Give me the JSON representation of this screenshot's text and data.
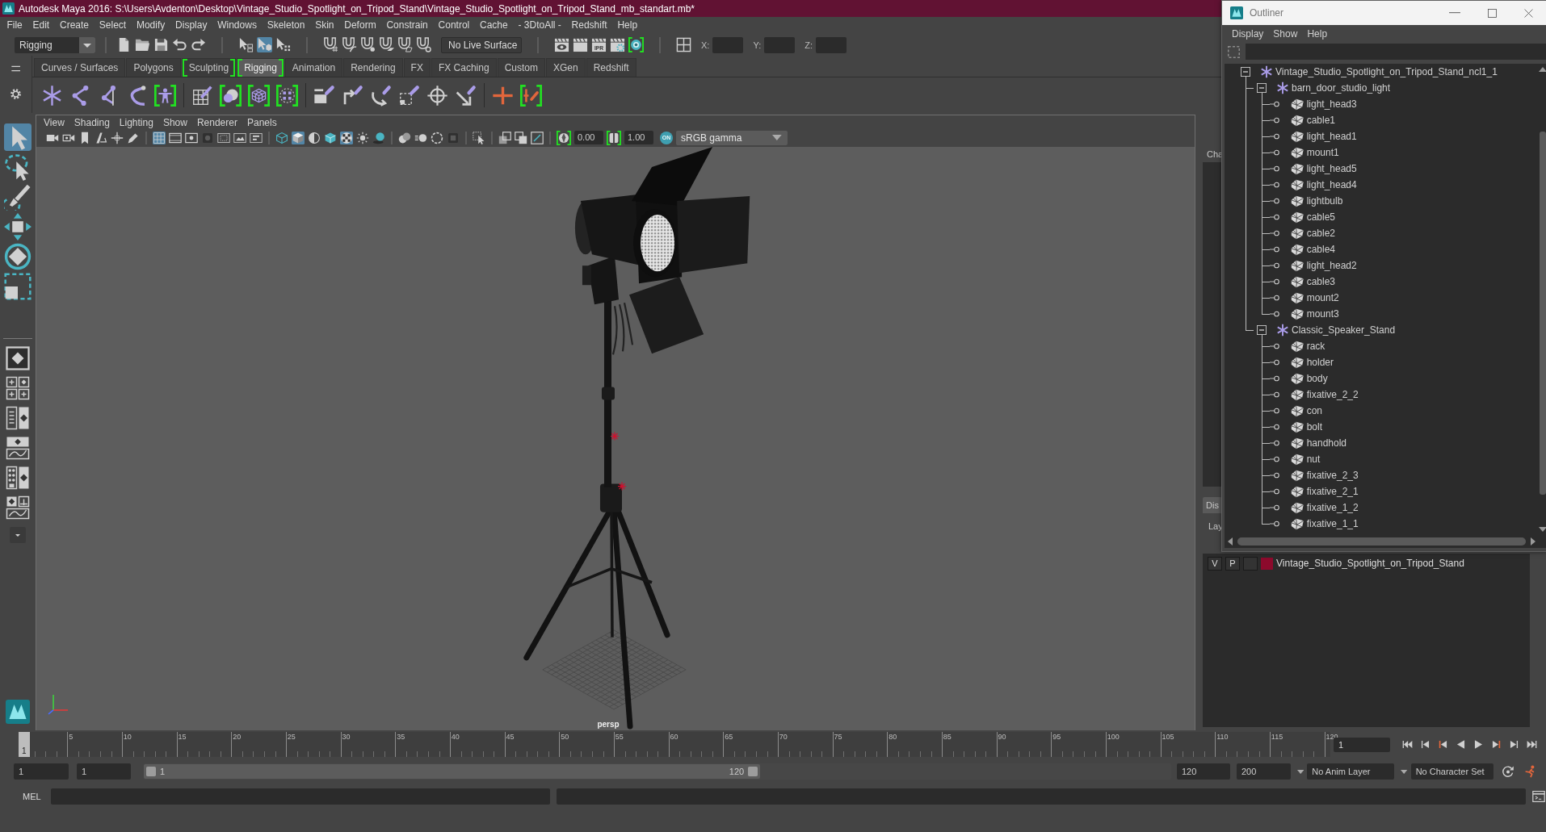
{
  "window": {
    "title": "Autodesk Maya 2016: S:\\Users\\Avdenton\\Desktop\\Vintage_Studio_Spotlight_on_Tripod_Stand\\Vintage_Studio_Spotlight_on_Tripod_Stand_mb_standart.mb*"
  },
  "menu_bar": [
    "File",
    "Edit",
    "Create",
    "Select",
    "Modify",
    "Display",
    "Windows",
    "Skeleton",
    "Skin",
    "Deform",
    "Constrain",
    "Control",
    "Cache",
    "- 3DtoAll -",
    "Redshift",
    "Help"
  ],
  "status_line": {
    "mode": "Rigging",
    "groups": [
      [
        {
          "kind": "file",
          "on": false,
          "highlighted": false
        },
        {
          "kind": "folder",
          "on": false,
          "highlighted": false
        },
        {
          "kind": "disk",
          "on": false,
          "highlighted": false
        },
        {
          "kind": "undo",
          "on": false,
          "highlighted": false
        },
        {
          "kind": "redo",
          "on": false,
          "highlighted": false
        }
      ],
      [
        {
          "kind": "hierarchy",
          "on": false,
          "highlighted": false
        },
        {
          "kind": "object",
          "on": true,
          "highlighted": false
        },
        {
          "kind": "component",
          "on": false,
          "highlighted": false
        }
      ],
      [
        {
          "kind": "snapgrid",
          "on": false,
          "highlighted": false
        },
        {
          "kind": "snapcurve",
          "on": false,
          "highlighted": false
        },
        {
          "kind": "snappoint",
          "on": false,
          "highlighted": false
        },
        {
          "kind": "snapplane",
          "on": false,
          "highlighted": false
        },
        {
          "kind": "snapsurface",
          "on": false,
          "highlighted": false
        },
        {
          "kind": "snapcenter",
          "on": false,
          "highlighted": false
        }
      ],
      [
        {
          "kind": "renderview",
          "on": false,
          "highlighted": false
        },
        {
          "kind": "render",
          "on": false,
          "highlighted": false
        },
        {
          "kind": "ipr",
          "label": "IPR",
          "on": false,
          "highlighted": false
        },
        {
          "kind": "rendersettings",
          "on": false,
          "highlighted": false
        },
        {
          "kind": "hypershade",
          "on": false,
          "highlighted": true
        }
      ],
      [
        {
          "kind": "transform",
          "on": false,
          "highlighted": false
        }
      ]
    ],
    "live_surface": "No Live Surface",
    "coordinates": [
      {
        "label": "X:"
      },
      {
        "label": "Y:"
      },
      {
        "label": "Z:"
      }
    ]
  },
  "shelf": {
    "tabs": [
      {
        "label": "Curves / Surfaces",
        "selected": false,
        "highlighted": false
      },
      {
        "label": "Polygons",
        "selected": false,
        "highlighted": false
      },
      {
        "label": "Sculpting",
        "selected": false,
        "highlighted": true
      },
      {
        "label": "Rigging",
        "selected": true,
        "highlighted": true
      },
      {
        "label": "Animation",
        "selected": false,
        "highlighted": false
      },
      {
        "label": "Rendering",
        "selected": false,
        "highlighted": false
      },
      {
        "label": "FX",
        "selected": false,
        "highlighted": false
      },
      {
        "label": "FX Caching",
        "selected": false,
        "highlighted": false
      },
      {
        "label": "Custom",
        "selected": false,
        "highlighted": false
      },
      {
        "label": "XGen",
        "selected": false,
        "highlighted": false
      },
      {
        "label": "Redshift",
        "selected": false,
        "highlighted": false
      }
    ],
    "groups": [
      [
        {
          "kind": "joint",
          "highlighted": false
        },
        {
          "kind": "bone",
          "highlighted": false
        },
        {
          "kind": "ikhandle",
          "highlighted": false
        },
        {
          "kind": "ikspline",
          "highlighted": false
        },
        {
          "kind": "humanik",
          "highlighted": true
        }
      ],
      [
        {
          "kind": "bind",
          "highlighted": false
        },
        {
          "kind": "interactive",
          "highlighted": true
        },
        {
          "kind": "lattice",
          "highlighted": true
        },
        {
          "kind": "cluster",
          "highlighted": true
        }
      ],
      [
        {
          "kind": "parent",
          "highlighted": false
        },
        {
          "kind": "point",
          "highlighted": false
        },
        {
          "kind": "orient",
          "highlighted": false
        },
        {
          "kind": "scaleconstraint",
          "highlighted": false
        },
        {
          "kind": "aim",
          "highlighted": false
        },
        {
          "kind": "pole",
          "highlighted": false
        }
      ],
      [
        {
          "kind": "cross",
          "highlighted": false
        },
        {
          "kind": "crosslink",
          "highlighted": true
        }
      ]
    ]
  },
  "toolbox": {
    "tools": [
      {
        "kind": "select",
        "selected": true
      },
      {
        "kind": "lasso",
        "selected": false
      },
      {
        "kind": "paint",
        "selected": false
      },
      {
        "kind": "move",
        "selected": false
      },
      {
        "kind": "rotate",
        "selected": false
      },
      {
        "kind": "scale",
        "selected": false
      }
    ],
    "layouts": [
      {
        "kind": "single"
      },
      {
        "kind": "four"
      },
      {
        "kind": "side"
      },
      {
        "kind": "graph"
      },
      {
        "kind": "column"
      },
      {
        "kind": "hyper"
      }
    ]
  },
  "viewport": {
    "menu": [
      "View",
      "Shading",
      "Lighting",
      "Show",
      "Renderer",
      "Panels"
    ],
    "groups": [
      [
        {
          "kind": "camera",
          "on": false
        },
        {
          "kind": "camattr",
          "on": false
        },
        {
          "kind": "bookmark",
          "on": false
        },
        {
          "kind": "imageplane",
          "on": false
        },
        {
          "kind": "pan",
          "on": false
        },
        {
          "kind": "pencil",
          "on": false
        }
      ],
      [
        {
          "kind": "grid",
          "on": true
        },
        {
          "kind": "filmgate",
          "on": false
        },
        {
          "kind": "resgate",
          "on": false
        },
        {
          "kind": "gatemask",
          "on": false
        },
        {
          "kind": "fieldchart",
          "on": false
        },
        {
          "kind": "safeaction",
          "on": false
        },
        {
          "kind": "safetitle",
          "on": false
        }
      ],
      [
        {
          "kind": "wirecube",
          "on": false
        },
        {
          "kind": "shadedcube",
          "on": true
        },
        {
          "kind": "halfshade",
          "on": false
        },
        {
          "kind": "wireonshaded",
          "on": false
        },
        {
          "kind": "checker",
          "on": true
        },
        {
          "kind": "lights",
          "on": false
        },
        {
          "kind": "shadows",
          "on": false
        }
      ],
      [
        {
          "kind": "ao",
          "on": false
        },
        {
          "kind": "motionblur",
          "on": false
        },
        {
          "kind": "antialias",
          "on": false
        },
        {
          "kind": "dof",
          "on": false
        }
      ],
      [
        {
          "kind": "isolate",
          "on": false
        }
      ],
      [
        {
          "kind": "xray",
          "on": false
        },
        {
          "kind": "xrayjoint",
          "on": false
        },
        {
          "kind": "xraycomp",
          "on": false
        }
      ]
    ],
    "exposure": {
      "highlighted": true,
      "value": "0.00"
    },
    "gamma": {
      "highlighted": true,
      "value": "1.00"
    },
    "color_management": {
      "on": true,
      "toggle": "ON",
      "value": "sRGB gamma"
    },
    "camera": "persp"
  },
  "channel_box": {
    "tab": "Cha"
  },
  "layer_editor": {
    "tab": "Dis",
    "menu": "Lay",
    "layers": [
      {
        "visible": "V",
        "playback": "P",
        "name": "Vintage_Studio_Spotlight_on_Tripod_Stand",
        "color": "#8c0a2c"
      }
    ]
  },
  "time_slider": {
    "current": "1",
    "ticks": [
      "5",
      "10",
      "15",
      "20",
      "25",
      "30",
      "35",
      "40",
      "45",
      "50",
      "55",
      "60",
      "65",
      "70",
      "75",
      "80",
      "85",
      "90",
      "95",
      "100",
      "105",
      "110",
      "115",
      "120"
    ],
    "current_frame": "1"
  },
  "range_slider": {
    "start": "1",
    "playback_start": "1",
    "level": 0.6,
    "range_start": "1",
    "range_end": "120",
    "playback_end": "120",
    "end": "200",
    "anim_layer": "No Anim Layer",
    "character_set": "No Character Set"
  },
  "command_line": {
    "language": "MEL"
  },
  "outliner": {
    "title": "Outliner",
    "menu": [
      "Display",
      "Show",
      "Help"
    ],
    "tree": [
      {
        "label": "Vintage_Studio_Spotlight_on_Tripod_Stand_ncl1_1",
        "kind": "group",
        "expanded": true,
        "selected": false,
        "children": [
          {
            "label": "barn_door_studio_light",
            "kind": "group",
            "expanded": true,
            "selected": false,
            "children": [
              {
                "label": "light_head3",
                "kind": "mesh",
                "selected": false
              },
              {
                "label": "cable1",
                "kind": "mesh",
                "selected": false
              },
              {
                "label": "light_head1",
                "kind": "mesh",
                "selected": false
              },
              {
                "label": "mount1",
                "kind": "mesh",
                "selected": false
              },
              {
                "label": "light_head5",
                "kind": "mesh",
                "selected": false
              },
              {
                "label": "light_head4",
                "kind": "mesh",
                "selected": false
              },
              {
                "label": "lightbulb",
                "kind": "mesh",
                "selected": false
              },
              {
                "label": "cable5",
                "kind": "mesh",
                "selected": false
              },
              {
                "label": "cable2",
                "kind": "mesh",
                "selected": false
              },
              {
                "label": "cable4",
                "kind": "mesh",
                "selected": false
              },
              {
                "label": "light_head2",
                "kind": "mesh",
                "selected": false
              },
              {
                "label": "cable3",
                "kind": "mesh",
                "selected": false
              },
              {
                "label": "mount2",
                "kind": "mesh",
                "selected": false
              },
              {
                "label": "mount3",
                "kind": "mesh",
                "selected": false
              }
            ]
          },
          {
            "label": "Classic_Speaker_Stand",
            "kind": "group",
            "expanded": true,
            "selected": false,
            "children": [
              {
                "label": "rack",
                "kind": "mesh",
                "selected": false
              },
              {
                "label": "holder",
                "kind": "mesh",
                "selected": false
              },
              {
                "label": "body",
                "kind": "mesh",
                "selected": false
              },
              {
                "label": "fixative_2_2",
                "kind": "mesh",
                "selected": false
              },
              {
                "label": "con",
                "kind": "mesh",
                "selected": false
              },
              {
                "label": "bolt",
                "kind": "mesh",
                "selected": false
              },
              {
                "label": "handhold",
                "kind": "mesh",
                "selected": false
              },
              {
                "label": "nut",
                "kind": "mesh",
                "selected": false
              },
              {
                "label": "fixative_2_3",
                "kind": "mesh",
                "selected": false
              },
              {
                "label": "fixative_2_1",
                "kind": "mesh",
                "selected": false
              },
              {
                "label": "fixative_1_2",
                "kind": "mesh",
                "selected": false
              },
              {
                "label": "fixative_1_1",
                "kind": "mesh",
                "selected": false
              }
            ]
          }
        ]
      }
    ]
  }
}
